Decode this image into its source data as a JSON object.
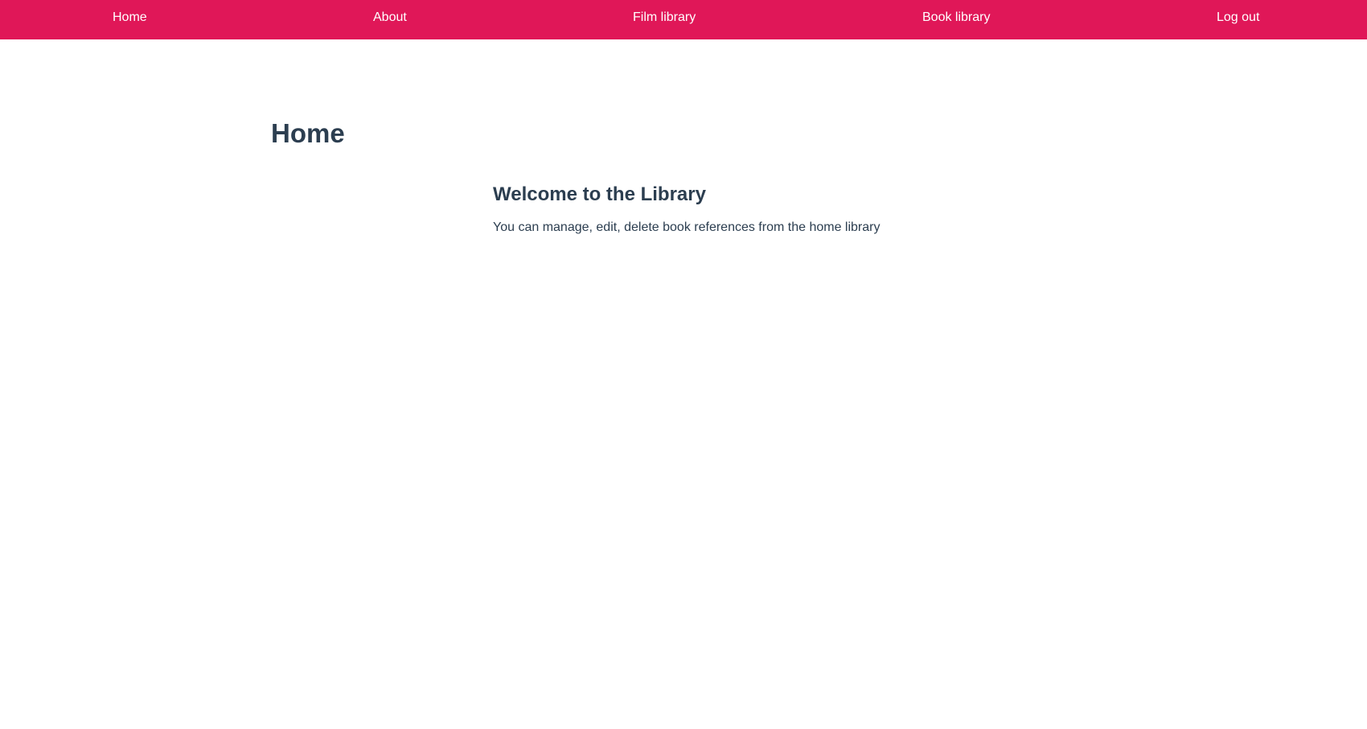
{
  "nav": {
    "items": [
      {
        "label": "Home"
      },
      {
        "label": "About"
      },
      {
        "label": "Film library"
      },
      {
        "label": "Book library"
      },
      {
        "label": "Log out"
      }
    ]
  },
  "page": {
    "title": "Home"
  },
  "main": {
    "heading": "Welcome to the Library",
    "text": "You can manage, edit, delete book references from the home library"
  },
  "colors": {
    "navbar_background": "#e01758",
    "nav_text": "#ffffff",
    "text": "#2c3e50",
    "background": "#ffffff"
  }
}
